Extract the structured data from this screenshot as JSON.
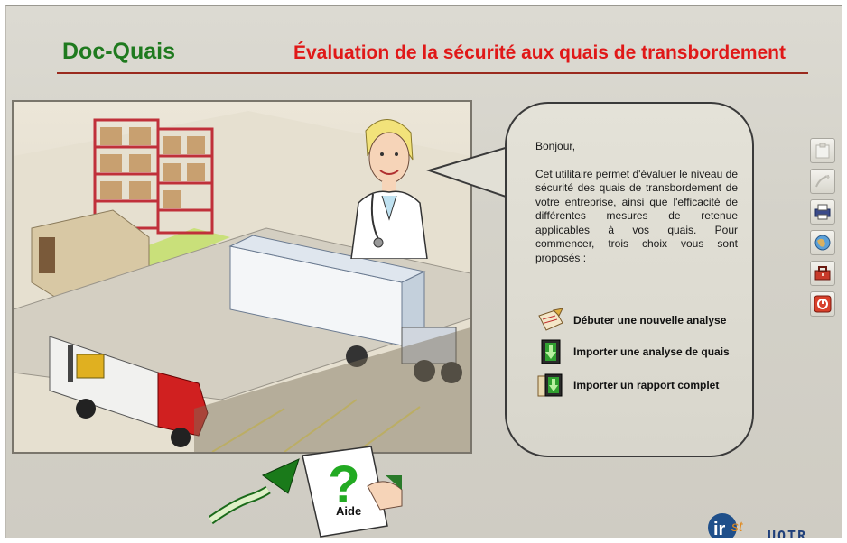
{
  "header": {
    "app_title": "Doc-Quais",
    "subtitle": "Évaluation de la sécurité aux quais de transbordement"
  },
  "bubble": {
    "greeting": "Bonjour,",
    "body": "Cet utilitaire permet d'évaluer le niveau de sécurité des quais de transbordement de votre entreprise, ainsi que l'efficacité de différentes mesures de retenue applicables à vos quais. Pour commencer, trois choix vous sont proposés :",
    "actions": [
      {
        "label": "Débuter une nouvelle analyse",
        "icon": "new-analysis-icon"
      },
      {
        "label": "Importer une analyse de quais",
        "icon": "import-dock-analysis-icon"
      },
      {
        "label": "Importer un rapport complet",
        "icon": "import-report-icon"
      }
    ]
  },
  "toolbar": [
    {
      "icon": "clipboard-icon"
    },
    {
      "icon": "pen-icon"
    },
    {
      "icon": "printer-icon"
    },
    {
      "icon": "globe-icon"
    },
    {
      "icon": "toolbox-icon"
    },
    {
      "icon": "power-icon"
    }
  ],
  "help": {
    "label": "Aide"
  },
  "logos": {
    "left": "irsst",
    "right": "UQTR"
  },
  "colors": {
    "app_title": "#1f7a1f",
    "subtitle": "#e01818",
    "rule": "#9a2a1e"
  }
}
